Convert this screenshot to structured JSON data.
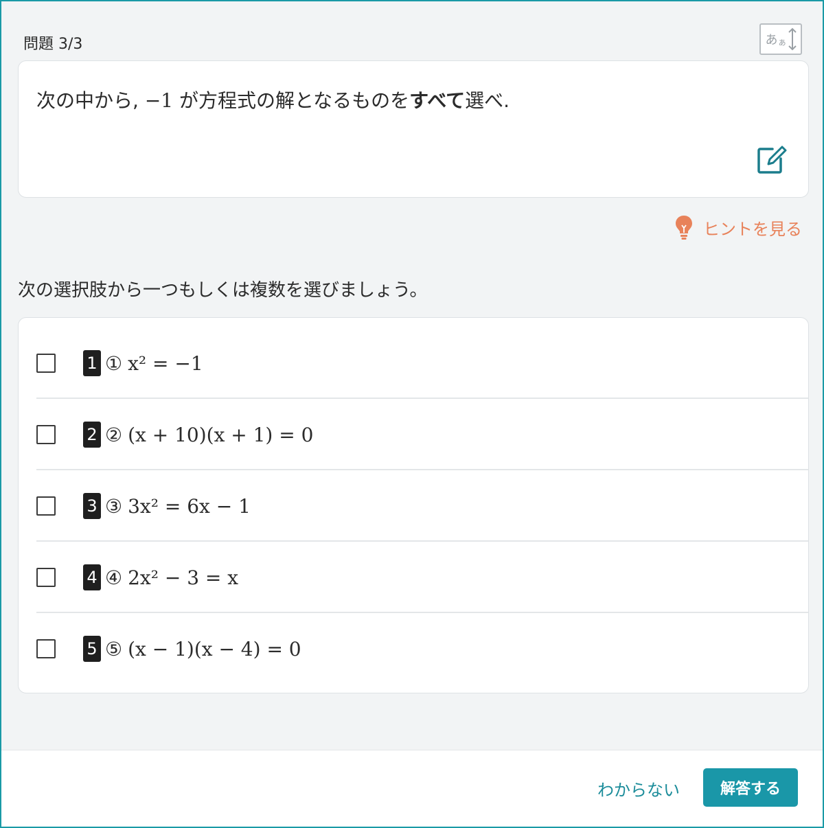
{
  "header": {
    "counter": "問題 3/3",
    "font_size_button": {
      "large": "あ",
      "small": "ぁ"
    }
  },
  "question": {
    "text_before": "次の中から, ",
    "math": "−1",
    "text_middle": " が方程式の解となるものを",
    "emphasis": "すべて",
    "text_after": "選べ."
  },
  "hint": {
    "label": "ヒントを見る",
    "icon": "lightbulb-icon",
    "color": "#e8825a"
  },
  "instruction": "次の選択肢から一つもしくは複数を選びましょう。",
  "choices": [
    {
      "number": "1",
      "circled": "①",
      "formula": "x² = −1"
    },
    {
      "number": "2",
      "circled": "②",
      "formula": "(x + 10)(x + 1) = 0"
    },
    {
      "number": "3",
      "circled": "③",
      "formula": "3x² = 6x − 1"
    },
    {
      "number": "4",
      "circled": "④",
      "formula": "2x² − 3 = x"
    },
    {
      "number": "5",
      "circled": "⑤",
      "formula": "(x − 1)(x − 4) = 0"
    }
  ],
  "footer": {
    "skip_label": "わからない",
    "submit_label": "解答する"
  },
  "colors": {
    "accent": "#1a97a8",
    "hint": "#e8825a",
    "frame": "#1a9aa6"
  }
}
